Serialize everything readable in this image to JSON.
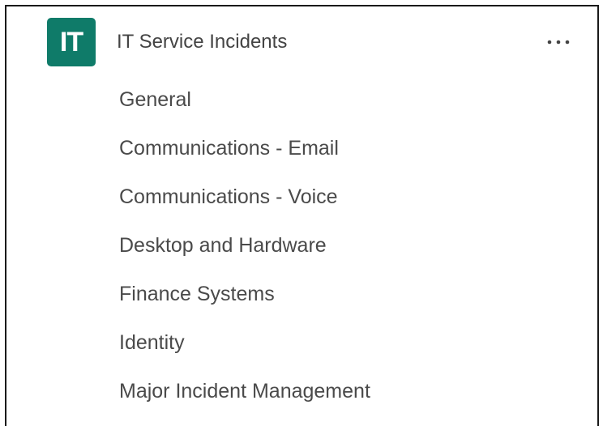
{
  "team": {
    "avatar_text": "IT",
    "avatar_color": "#0f7b69",
    "name": "IT Service Incidents",
    "more_icon": "more-horizontal-icon"
  },
  "channels": [
    {
      "label": "General"
    },
    {
      "label": "Communications - Email"
    },
    {
      "label": "Communications - Voice"
    },
    {
      "label": "Desktop and Hardware"
    },
    {
      "label": "Finance Systems"
    },
    {
      "label": "Identity"
    },
    {
      "label": "Major Incident Management"
    }
  ]
}
